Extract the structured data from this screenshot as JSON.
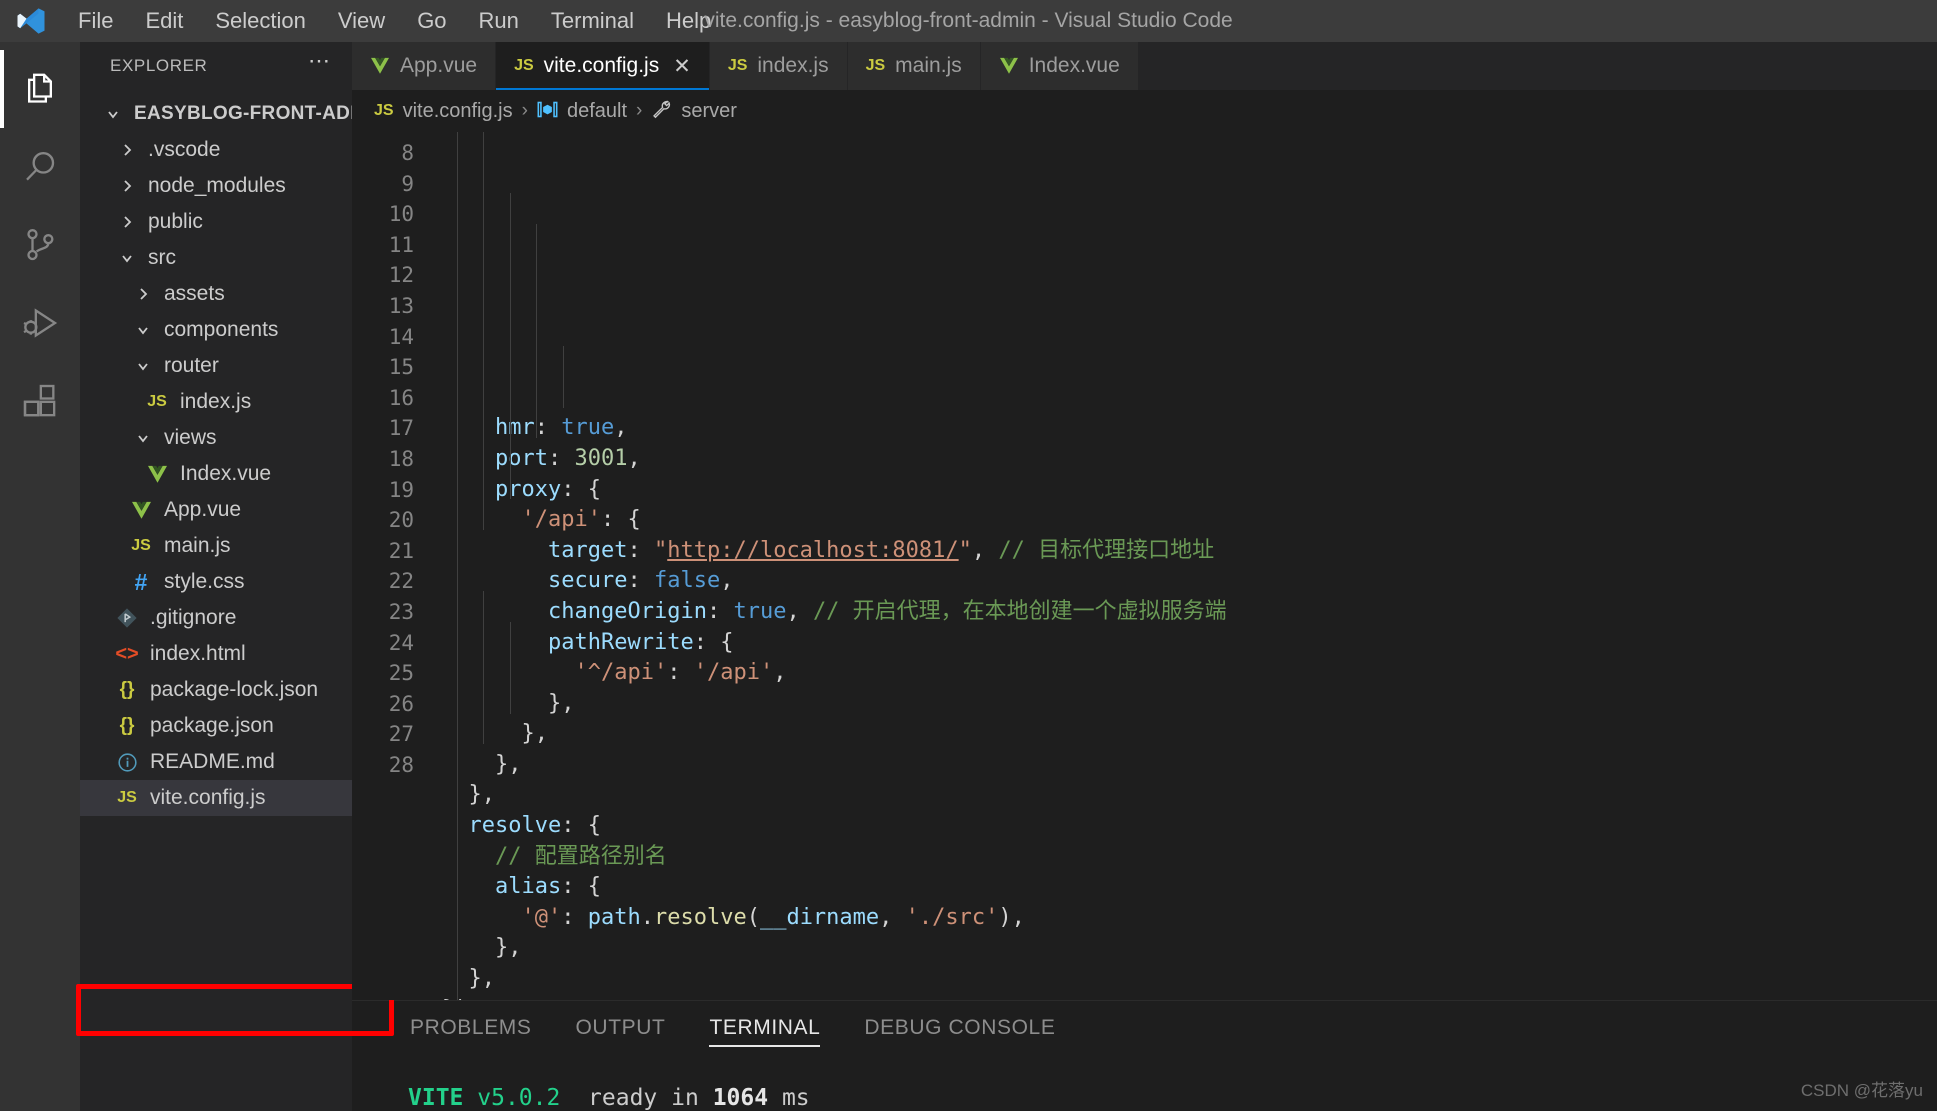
{
  "window": {
    "title": "vite.config.js - easyblog-front-admin - Visual Studio Code",
    "logo_icon": "vscode-logo-icon"
  },
  "menu": {
    "items": [
      {
        "label": "File"
      },
      {
        "label": "Edit"
      },
      {
        "label": "Selection"
      },
      {
        "label": "View"
      },
      {
        "label": "Go"
      },
      {
        "label": "Run"
      },
      {
        "label": "Terminal"
      },
      {
        "label": "Help"
      }
    ]
  },
  "activity_bar": {
    "items": [
      {
        "name": "explorer-icon",
        "active": true
      },
      {
        "name": "search-icon",
        "active": false
      },
      {
        "name": "source-control-icon",
        "active": false
      },
      {
        "name": "run-and-debug-icon",
        "active": false
      },
      {
        "name": "extensions-icon",
        "active": false
      }
    ]
  },
  "sidebar": {
    "title": "EXPLORER",
    "more_actions": "⋯",
    "tree": [
      {
        "label": "EASYBLOG-FRONT-ADMIN",
        "depth": 0,
        "type": "root",
        "expanded": true
      },
      {
        "label": ".vscode",
        "depth": 1,
        "type": "folder",
        "expanded": false
      },
      {
        "label": "node_modules",
        "depth": 1,
        "type": "folder",
        "expanded": false
      },
      {
        "label": "public",
        "depth": 1,
        "type": "folder",
        "expanded": false
      },
      {
        "label": "src",
        "depth": 1,
        "type": "folder",
        "expanded": true
      },
      {
        "label": "assets",
        "depth": 2,
        "type": "folder",
        "expanded": false
      },
      {
        "label": "components",
        "depth": 2,
        "type": "folder",
        "expanded": true
      },
      {
        "label": "router",
        "depth": 2,
        "type": "folder",
        "expanded": true
      },
      {
        "label": "index.js",
        "depth": 3,
        "type": "file",
        "icon": "js"
      },
      {
        "label": "views",
        "depth": 2,
        "type": "folder",
        "expanded": true
      },
      {
        "label": "Index.vue",
        "depth": 3,
        "type": "file",
        "icon": "vue"
      },
      {
        "label": "App.vue",
        "depth": 2,
        "type": "file",
        "icon": "vue"
      },
      {
        "label": "main.js",
        "depth": 2,
        "type": "file",
        "icon": "js"
      },
      {
        "label": "style.css",
        "depth": 2,
        "type": "file",
        "icon": "css"
      },
      {
        "label": ".gitignore",
        "depth": 1,
        "type": "file",
        "icon": "git"
      },
      {
        "label": "index.html",
        "depth": 1,
        "type": "file",
        "icon": "html"
      },
      {
        "label": "package-lock.json",
        "depth": 1,
        "type": "file",
        "icon": "json"
      },
      {
        "label": "package.json",
        "depth": 1,
        "type": "file",
        "icon": "json"
      },
      {
        "label": "README.md",
        "depth": 1,
        "type": "file",
        "icon": "md"
      },
      {
        "label": "vite.config.js",
        "depth": 1,
        "type": "file",
        "icon": "js",
        "selected": true,
        "highlighted": true
      }
    ],
    "highlight_color": "#ff0000"
  },
  "tabs": [
    {
      "label": "App.vue",
      "icon": "vue-icon",
      "active": false,
      "closable": false
    },
    {
      "label": "vite.config.js",
      "icon": "js-icon",
      "active": true,
      "closable": true,
      "close_glyph": "✕"
    },
    {
      "label": "index.js",
      "icon": "js-icon",
      "active": false,
      "closable": false
    },
    {
      "label": "main.js",
      "icon": "js-icon",
      "active": false,
      "closable": false
    },
    {
      "label": "Index.vue",
      "icon": "vue-icon",
      "active": false,
      "closable": false
    }
  ],
  "breadcrumb": {
    "file_icon": "JS",
    "file": "vite.config.js",
    "sep1": "›",
    "symbol_icon": "cube-icon",
    "symbol": "default",
    "sep2": "›",
    "member_icon": "wrench-icon",
    "member": "server"
  },
  "editor": {
    "first_line": 8,
    "lines": [
      {
        "n": 8,
        "text": "    hmr: true,"
      },
      {
        "n": 9,
        "text": "    port: 3001,"
      },
      {
        "n": 10,
        "text": "    proxy: {"
      },
      {
        "n": 11,
        "text": "      '/api': {"
      },
      {
        "n": 12,
        "text": "        target: \"http://localhost:8081/\", // 目标代理接口地址"
      },
      {
        "n": 13,
        "text": "        secure: false,"
      },
      {
        "n": 14,
        "text": "        changeOrigin: true, // 开启代理，在本地创建一个虚拟服务端"
      },
      {
        "n": 15,
        "text": "        pathRewrite: {"
      },
      {
        "n": 16,
        "text": "          '^/api': '/api',"
      },
      {
        "n": 17,
        "text": "        },"
      },
      {
        "n": 18,
        "text": "      },"
      },
      {
        "n": 19,
        "text": "    },"
      },
      {
        "n": 20,
        "text": "  },"
      },
      {
        "n": 21,
        "text": "  resolve: {"
      },
      {
        "n": 22,
        "text": "    // 配置路径别名"
      },
      {
        "n": 23,
        "text": "    alias: {"
      },
      {
        "n": 24,
        "text": "      '@': path.resolve(__dirname, './src'),"
      },
      {
        "n": 25,
        "text": "    },"
      },
      {
        "n": 26,
        "text": "  },"
      },
      {
        "n": 27,
        "text": "})"
      },
      {
        "n": 28,
        "text": ""
      }
    ],
    "colors": {
      "property": "#9cdcfe",
      "keyword": "#569cd6",
      "string": "#ce9178",
      "number": "#b5cea8",
      "comment": "#6a9955",
      "plain": "#d4d4d4",
      "function": "#dcdcaa",
      "line_number": "#858585",
      "background": "#1e1e1e"
    }
  },
  "panel": {
    "tabs": [
      {
        "label": "PROBLEMS",
        "active": false
      },
      {
        "label": "OUTPUT",
        "active": false
      },
      {
        "label": "TERMINAL",
        "active": true
      },
      {
        "label": "DEBUG CONSOLE",
        "active": false
      }
    ],
    "terminal": {
      "vite_label": "VITE",
      "version": "v5.0.2",
      "ready_text": "ready in",
      "duration": "1064",
      "unit": "ms",
      "accent_color": "#23d18b"
    }
  },
  "watermark": "CSDN @花落yu"
}
